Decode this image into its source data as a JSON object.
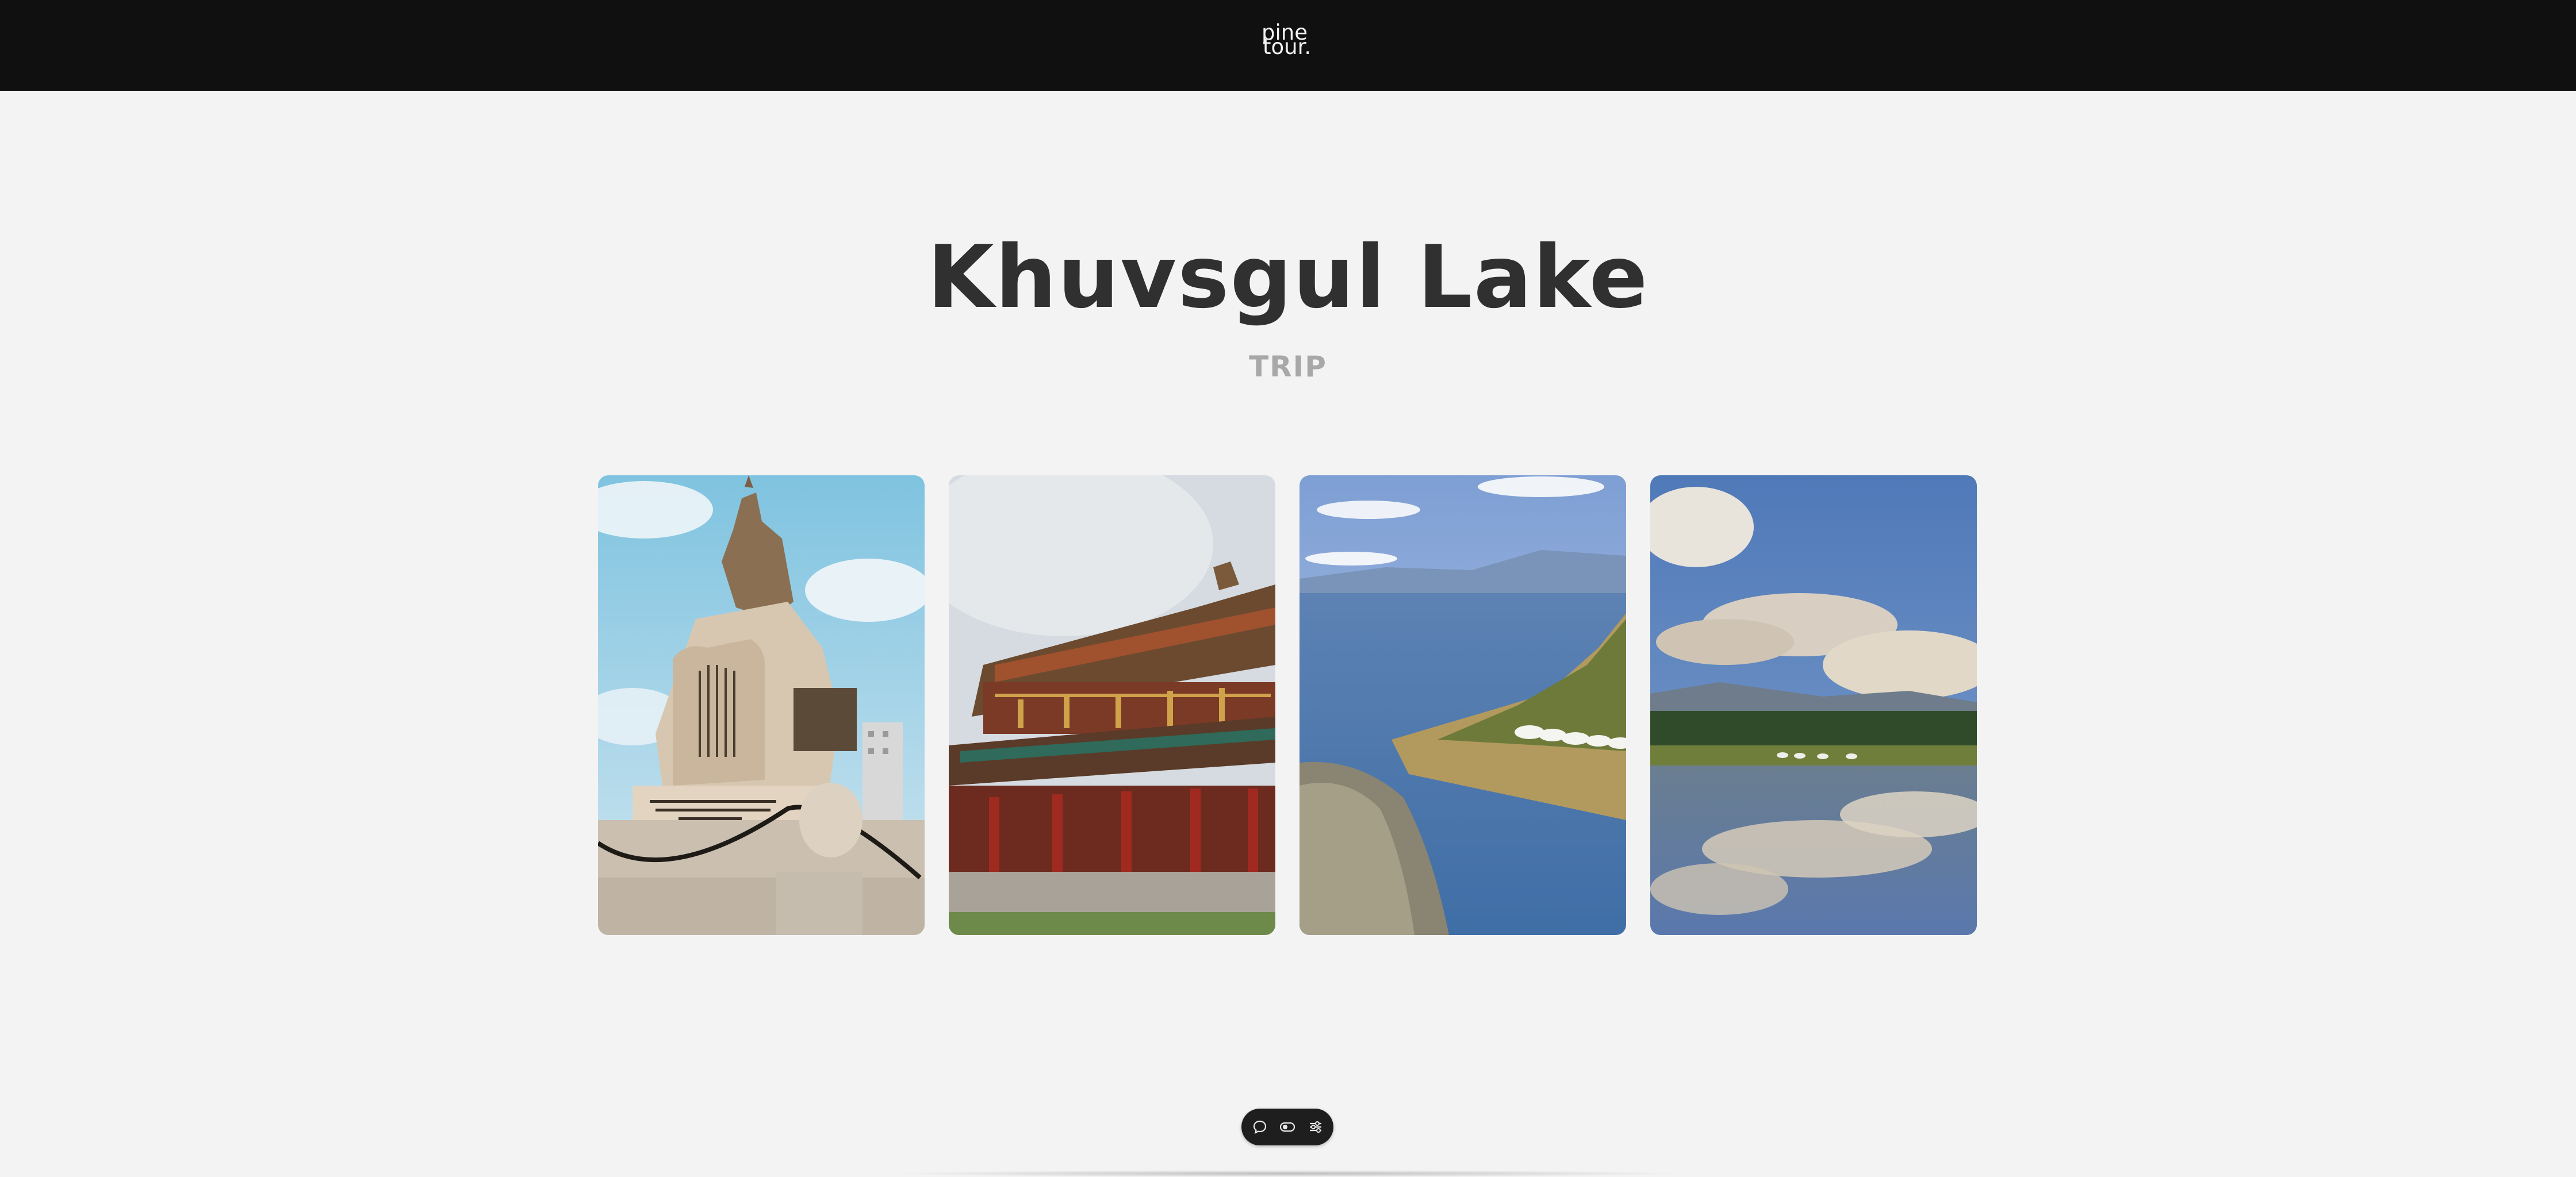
{
  "brand": {
    "line1": "pine",
    "line2": "tour."
  },
  "hero": {
    "title": "Khuvsgul Lake",
    "subtitle": "TRIP"
  },
  "gallery": [
    {
      "subject": "equestrian monument with inscribed stone and lion statue"
    },
    {
      "subject": "traditional monastery temple with ornate roofs"
    },
    {
      "subject": "lake shoreline with rocks and white ger camps"
    },
    {
      "subject": "cloudy sky reflected in calm lake with forest and gers"
    }
  ],
  "toolbar": {
    "icons": [
      "chat-icon",
      "toggle-icon",
      "sliders-icon"
    ]
  },
  "colors": {
    "topbar": "#101010",
    "background": "#f3f3f3",
    "title": "#303030",
    "subtitle": "#a8a8a8"
  }
}
